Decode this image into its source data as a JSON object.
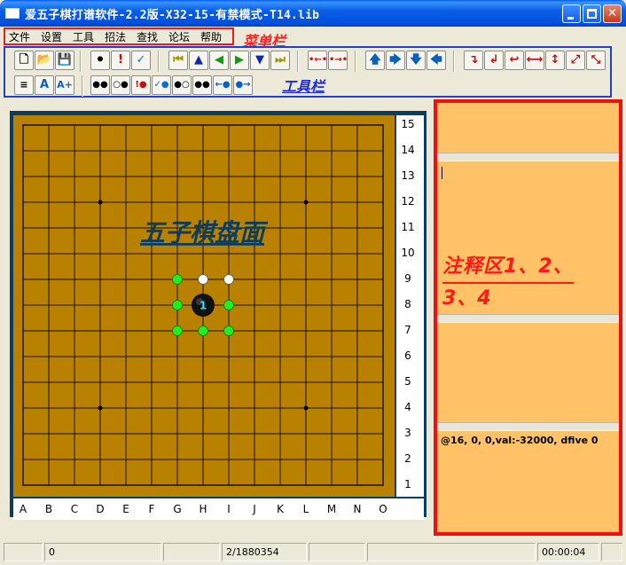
{
  "window": {
    "title": "爱五子棋打谱软件-2.2版-X32-15-有禁模式-T14.lib"
  },
  "menubar": {
    "items": [
      "文件",
      "设置",
      "工具",
      "招法",
      "查找",
      "论坛",
      "帮助"
    ],
    "annotation": "菜单栏"
  },
  "toolbar": {
    "annotation": "工具栏",
    "row1": [
      "new-icon",
      "open-icon",
      "save-icon",
      "stone-icon",
      "exclaim-icon",
      "check-icon",
      "first-icon",
      "up-icon",
      "left-icon",
      "right-icon",
      "down-icon",
      "last-icon",
      "dot-arrow-left-icon",
      "dot-arrow-right-icon",
      "move-up-icon",
      "move-right-icon",
      "move-down-icon",
      "move-left-icon",
      "rotate-right-icon",
      "rotate-left-icon",
      "flip-icon",
      "mirror-h-icon",
      "mirror-v-icon",
      "diag-1-icon",
      "diag-2-icon"
    ],
    "row2": [
      "text-icon",
      "font-a-icon",
      "font-a-plus-icon",
      "search-1-icon",
      "search-2-icon",
      "search-3-icon",
      "search-4-icon",
      "search-5-icon",
      "search-6-icon",
      "search-7-icon",
      "search-8-icon"
    ],
    "font_a_label": "A",
    "font_a_plus_label": "A+"
  },
  "board": {
    "annotation": "五子棋盘面",
    "columns": [
      "A",
      "B",
      "C",
      "D",
      "E",
      "F",
      "G",
      "H",
      "I",
      "J",
      "K",
      "L",
      "M",
      "N",
      "O"
    ],
    "rows": [
      "15",
      "14",
      "13",
      "12",
      "11",
      "10",
      "9",
      "8",
      "7",
      "6",
      "5",
      "4",
      "3",
      "2",
      "1"
    ],
    "stones": [
      {
        "col": "H",
        "row": 8,
        "color": "black",
        "number": "1"
      }
    ],
    "white_marks": [
      {
        "col": "H",
        "row": 9
      },
      {
        "col": "I",
        "row": 9
      }
    ],
    "green_marks": [
      {
        "col": "G",
        "row": 9
      },
      {
        "col": "G",
        "row": 8
      },
      {
        "col": "I",
        "row": 8
      },
      {
        "col": "G",
        "row": 7
      },
      {
        "col": "H",
        "row": 7
      },
      {
        "col": "I",
        "row": 7
      }
    ],
    "star_points": [
      "D12",
      "L12",
      "D4",
      "L4"
    ],
    "colors": {
      "board": "#b88200",
      "frame": "#0e3c5c",
      "line": "#1a1000",
      "green": "#22ee22"
    }
  },
  "annotation_area": {
    "title_line1": "注释区1、2、",
    "title_line2": "3、4",
    "status_text": "@16, 0,  0,val:-32000, dfive 0"
  },
  "statusbar": {
    "cells": [
      "",
      "0",
      "2/1880354",
      "",
      "",
      "00:00:04",
      ""
    ]
  }
}
